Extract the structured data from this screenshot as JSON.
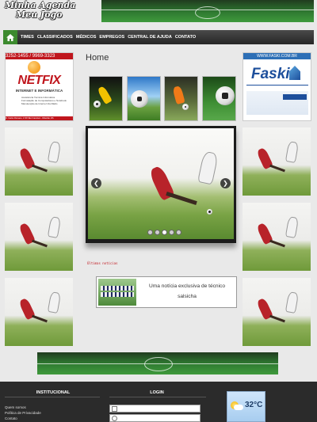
{
  "site": {
    "logo_line1": "Minha Agenda",
    "logo_line2": "Meu Jogo"
  },
  "nav": {
    "items": [
      "TIMES",
      "CLASSIFICADOS",
      "MÉDICOS",
      "EMPREGOS",
      "CENTRAL DE AJUDA",
      "CONTATO"
    ]
  },
  "main": {
    "title": "Home"
  },
  "ad_left": {
    "phone": "3252-1455 / 9969-3323",
    "brand": "NETFIX",
    "subtitle": "INTERNET E INFORMÁTICA",
    "services": [
      "Assistência Técnica Informática",
      "Formatação de Computadores e Notebook",
      "Manutenção de Internet Via Rádio"
    ],
    "footer": "R. Carlos Romano, 1718 São Francisco - Ribeirão, RS"
  },
  "ad_right": {
    "url": "WWW.FASKI.COM.BR",
    "brand": "Faski"
  },
  "slider": {
    "slide_count": 5,
    "active_index": 2
  },
  "news": {
    "label": "Últimas notícias",
    "headline": "Uma notícia exclusiva de técnico salsicha"
  },
  "footer": {
    "institucional_heading": "INSTITUCIONAL",
    "login_heading": "LOGIN",
    "links": [
      "Quem somos",
      "Política de Privacidade",
      "Contato"
    ],
    "weather_temp": "32°C"
  },
  "colors": {
    "nav_accent": "#3c8a2e",
    "ad_red": "#c0161d",
    "ad_blue": "#1d4f9c",
    "footer_bg": "#2b2b2b"
  }
}
